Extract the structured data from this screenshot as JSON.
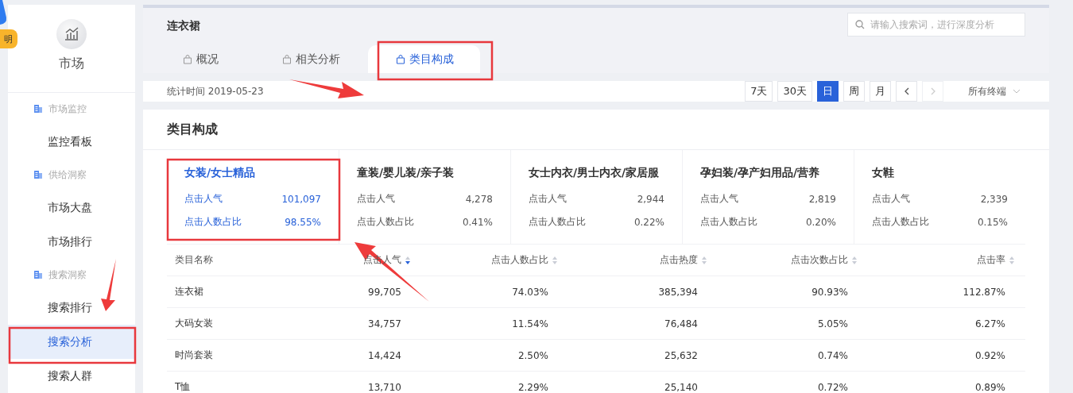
{
  "side_badge": {
    "label": "明"
  },
  "sidebar": {
    "title": "市场",
    "groups": [
      {
        "label": "市场监控",
        "items": [
          {
            "label": "监控看板",
            "selected": false
          }
        ]
      },
      {
        "label": "供给洞察",
        "items": [
          {
            "label": "市场大盘",
            "selected": false
          },
          {
            "label": "市场排行",
            "selected": false
          }
        ]
      },
      {
        "label": "搜索洞察",
        "items": [
          {
            "label": "搜索排行",
            "selected": false
          },
          {
            "label": "搜索分析",
            "selected": true
          },
          {
            "label": "搜索人群",
            "selected": false
          }
        ]
      }
    ]
  },
  "header": {
    "title": "连衣裙",
    "search": {
      "placeholder": "请输入搜索词，进行深度分析"
    },
    "tabs": [
      {
        "label": "概况",
        "selected": false
      },
      {
        "label": "相关分析",
        "selected": false
      },
      {
        "label": "类目构成",
        "selected": true
      }
    ]
  },
  "toolbar": {
    "date": "统计时间 2019-05-23",
    "ranges": [
      {
        "label": "7天",
        "selected": false
      },
      {
        "label": "30天",
        "selected": false
      },
      {
        "label": "日",
        "selected": true
      },
      {
        "label": "周",
        "selected": false
      },
      {
        "label": "月",
        "selected": false
      }
    ],
    "nav": [
      {
        "kind": "prev",
        "disabled": false
      },
      {
        "kind": "next",
        "disabled": true
      }
    ],
    "terminal": "所有终端"
  },
  "section": {
    "title": "类目构成",
    "categories": [
      {
        "name": "女装/女士精品",
        "selected": true,
        "metrics": [
          {
            "label": "点击人气",
            "value": "101,097"
          },
          {
            "label": "点击人数占比",
            "value": "98.55%"
          }
        ]
      },
      {
        "name": "童装/婴儿装/亲子装",
        "selected": false,
        "metrics": [
          {
            "label": "点击人气",
            "value": "4,278"
          },
          {
            "label": "点击人数占比",
            "value": "0.41%"
          }
        ]
      },
      {
        "name": "女士内衣/男士内衣/家居服",
        "selected": false,
        "metrics": [
          {
            "label": "点击人气",
            "value": "2,944"
          },
          {
            "label": "点击人数占比",
            "value": "0.22%"
          }
        ]
      },
      {
        "name": "孕妇装/孕产妇用品/营养",
        "selected": false,
        "metrics": [
          {
            "label": "点击人气",
            "value": "2,819"
          },
          {
            "label": "点击人数占比",
            "value": "0.20%"
          }
        ]
      },
      {
        "name": "女鞋",
        "selected": false,
        "metrics": [
          {
            "label": "点击人气",
            "value": "2,339"
          },
          {
            "label": "点击人数占比",
            "value": "0.15%"
          }
        ]
      }
    ],
    "table": {
      "columns": [
        {
          "label": "类目名称"
        },
        {
          "label": "点击人气",
          "sorted": true
        },
        {
          "label": "点击人数占比",
          "sorted": false
        },
        {
          "label": "点击热度",
          "sorted": false
        },
        {
          "label": "点击次数占比",
          "sorted": false
        },
        {
          "label": "点击率",
          "sorted": false
        }
      ],
      "rows": [
        [
          "连衣裙",
          "99,705",
          "74.03%",
          "385,394",
          "90.93%",
          "112.87%"
        ],
        [
          "大码女装",
          "34,757",
          "11.54%",
          "76,484",
          "5.05%",
          "6.27%"
        ],
        [
          "时尚套装",
          "14,424",
          "2.50%",
          "25,632",
          "0.74%",
          "0.92%"
        ],
        [
          "T恤",
          "13,710",
          "2.29%",
          "25,140",
          "0.72%",
          "0.89%"
        ]
      ]
    }
  }
}
